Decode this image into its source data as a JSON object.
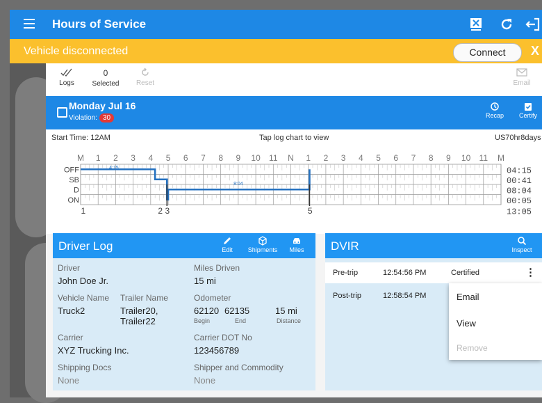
{
  "app_bar": {
    "title": "Hours of Service"
  },
  "banner": {
    "message": "Vehicle disconnected",
    "connect_label": "Connect",
    "close_label": "X"
  },
  "toolbar": {
    "logs_label": "Logs",
    "selected_count": "0",
    "selected_label": "Selected",
    "reset_label": "Reset",
    "email_label": "Email"
  },
  "day_header": {
    "date": "Monday Jul 16",
    "violation_label": "Violation:",
    "violation_count": "30",
    "recap_label": "Recap",
    "certify_label": "Certify"
  },
  "chart": {
    "start_time": "Start Time: 12AM",
    "hint": "Tap log chart to view",
    "ruleset": "US70hr8days",
    "hours": [
      "M",
      "1",
      "2",
      "3",
      "4",
      "5",
      "6",
      "7",
      "8",
      "9",
      "10",
      "11",
      "N",
      "1",
      "2",
      "3",
      "4",
      "5",
      "6",
      "7",
      "8",
      "9",
      "10",
      "11",
      "M"
    ],
    "rows": [
      "OFF",
      "SB",
      "D",
      "ON"
    ],
    "totals": [
      "04:15",
      "00:41",
      "08:04",
      "00:05"
    ],
    "grand_total": "13:05",
    "segment_labels": [
      "4:15",
      "8:04"
    ],
    "markers": [
      "1",
      "2",
      "3",
      "5"
    ]
  },
  "chart_data": {
    "type": "line",
    "title": "",
    "xlabel": "",
    "ylabel": "",
    "xlim": [
      0,
      24
    ],
    "y_categories": [
      "OFF",
      "SB",
      "D",
      "ON"
    ],
    "series": [
      {
        "points": [
          [
            0,
            "OFF"
          ],
          [
            4.25,
            "OFF"
          ],
          [
            4.25,
            "SB"
          ],
          [
            4.93,
            "SB"
          ],
          [
            4.93,
            "ON"
          ],
          [
            5.0,
            "ON"
          ],
          [
            5.0,
            "D"
          ],
          [
            13.07,
            "D"
          ],
          [
            13.07,
            "OFF"
          ]
        ]
      }
    ]
  },
  "driver_log": {
    "title": "Driver Log",
    "edit_label": "Edit",
    "shipments_label": "Shipments",
    "miles_label": "Miles",
    "driver_label": "Driver",
    "driver_value": "John Doe Jr.",
    "miles_driven_label": "Miles Driven",
    "miles_driven_value": "15 mi",
    "vehicle_name_label": "Vehicle Name",
    "vehicle_name_value": "Truck2",
    "trailer_name_label": "Trailer Name",
    "trailer_line1": "Trailer20,",
    "trailer_line2": "Trailer22",
    "odometer_label": "Odometer",
    "odo_begin": "62120",
    "odo_end": "62135",
    "odo_distance": "15 mi",
    "begin_label": "Begin",
    "end_label": "End",
    "distance_label": "Distance",
    "carrier_label": "Carrier",
    "carrier_value": "XYZ Trucking Inc.",
    "carrier_dot_label": "Carrier DOT No",
    "carrier_dot_value": "123456789",
    "shipping_docs_label": "Shipping Docs",
    "shipping_docs_value": "None",
    "shipper_label": "Shipper and Commodity",
    "shipper_value": "None"
  },
  "dvir": {
    "title": "DVIR",
    "inspect_label": "Inspect",
    "rows": [
      {
        "type": "Pre-trip",
        "time": "12:54:56 PM",
        "status": "Certified"
      },
      {
        "type": "Post-trip",
        "time": "12:58:54 PM",
        "status": ""
      }
    ],
    "menu": [
      "Email",
      "View",
      "Remove"
    ]
  },
  "colors": {
    "primary": "#1e88e5",
    "banner": "#fbc02d",
    "violation": "#e53935",
    "log_line": "#2471c0"
  }
}
